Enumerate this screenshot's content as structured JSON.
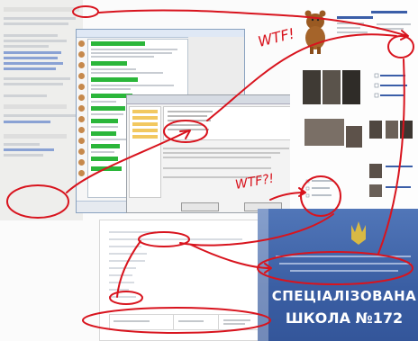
{
  "annotations": {
    "wtf_upper": "WTF!",
    "wtf_lower": "WTF?!"
  },
  "sign": {
    "line1": "СПЕЦІАЛІЗОВАНА",
    "line2": "ШКОЛА №172"
  },
  "colors": {
    "ink": "#d8141e",
    "sign_blue": "#3e62a8",
    "chat_green": "#2bb63a",
    "link_blue": "#2b57b8"
  },
  "icons": [
    "bear-avatar-icon",
    "trident-emblem-icon",
    "user-avatar-icon"
  ]
}
